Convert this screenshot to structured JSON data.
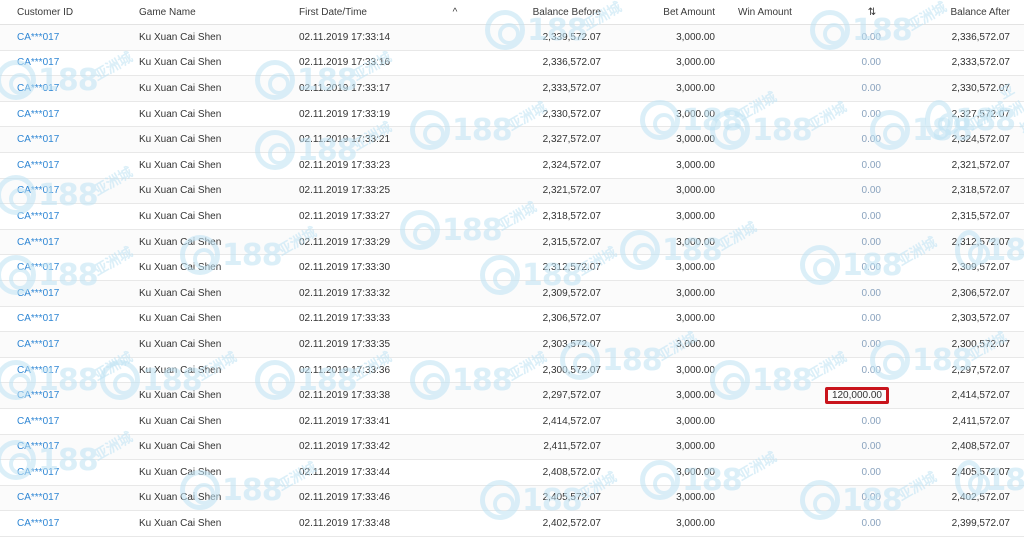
{
  "header": {
    "customer_id": "Customer ID",
    "game_name": "Game Name",
    "first_date": "First Date/Time",
    "sort_up_icon": "^",
    "balance_before": "Balance Before",
    "bet_amount": "Bet Amount",
    "win_amount": "Win Amount",
    "sort_both_icon": "⇅",
    "balance_after": "Balance After"
  },
  "colors": {
    "link": "#2e86d4",
    "win_zero": "#8aa3be",
    "highlight_border": "#c9141c",
    "watermark": "#bfe3f4"
  },
  "watermark": {
    "brand": "188",
    "sub": "亚洲城"
  },
  "rows": [
    {
      "customer": "CA***017",
      "game": "Ku Xuan Cai Shen",
      "date": "02.11.2019 17:33:14",
      "balance_before": "2,339,572.07",
      "bet": "3,000.00",
      "win": "0.00",
      "balance_after": "2,336,572.07"
    },
    {
      "customer": "CA***017",
      "game": "Ku Xuan Cai Shen",
      "date": "02.11.2019 17:33:16",
      "balance_before": "2,336,572.07",
      "bet": "3,000.00",
      "win": "0.00",
      "balance_after": "2,333,572.07"
    },
    {
      "customer": "CA***017",
      "game": "Ku Xuan Cai Shen",
      "date": "02.11.2019 17:33:17",
      "balance_before": "2,333,572.07",
      "bet": "3,000.00",
      "win": "0.00",
      "balance_after": "2,330,572.07"
    },
    {
      "customer": "CA***017",
      "game": "Ku Xuan Cai Shen",
      "date": "02.11.2019 17:33:19",
      "balance_before": "2,330,572.07",
      "bet": "3,000.00",
      "win": "0.00",
      "balance_after": "2,327,572.07"
    },
    {
      "customer": "CA***017",
      "game": "Ku Xuan Cai Shen",
      "date": "02.11.2019 17:33:21",
      "balance_before": "2,327,572.07",
      "bet": "3,000.00",
      "win": "0.00",
      "balance_after": "2,324,572.07"
    },
    {
      "customer": "CA***017",
      "game": "Ku Xuan Cai Shen",
      "date": "02.11.2019 17:33:23",
      "balance_before": "2,324,572.07",
      "bet": "3,000.00",
      "win": "0.00",
      "balance_after": "2,321,572.07"
    },
    {
      "customer": "CA***017",
      "game": "Ku Xuan Cai Shen",
      "date": "02.11.2019 17:33:25",
      "balance_before": "2,321,572.07",
      "bet": "3,000.00",
      "win": "0.00",
      "balance_after": "2,318,572.07"
    },
    {
      "customer": "CA***017",
      "game": "Ku Xuan Cai Shen",
      "date": "02.11.2019 17:33:27",
      "balance_before": "2,318,572.07",
      "bet": "3,000.00",
      "win": "0.00",
      "balance_after": "2,315,572.07"
    },
    {
      "customer": "CA***017",
      "game": "Ku Xuan Cai Shen",
      "date": "02.11.2019 17:33:29",
      "balance_before": "2,315,572.07",
      "bet": "3,000.00",
      "win": "0.00",
      "balance_after": "2,312,572.07"
    },
    {
      "customer": "CA***017",
      "game": "Ku Xuan Cai Shen",
      "date": "02.11.2019 17:33:30",
      "balance_before": "2,312,572.07",
      "bet": "3,000.00",
      "win": "0.00",
      "balance_after": "2,309,572.07"
    },
    {
      "customer": "CA***017",
      "game": "Ku Xuan Cai Shen",
      "date": "02.11.2019 17:33:32",
      "balance_before": "2,309,572.07",
      "bet": "3,000.00",
      "win": "0.00",
      "balance_after": "2,306,572.07"
    },
    {
      "customer": "CA***017",
      "game": "Ku Xuan Cai Shen",
      "date": "02.11.2019 17:33:33",
      "balance_before": "2,306,572.07",
      "bet": "3,000.00",
      "win": "0.00",
      "balance_after": "2,303,572.07"
    },
    {
      "customer": "CA***017",
      "game": "Ku Xuan Cai Shen",
      "date": "02.11.2019 17:33:35",
      "balance_before": "2,303,572.07",
      "bet": "3,000.00",
      "win": "0.00",
      "balance_after": "2,300,572.07"
    },
    {
      "customer": "CA***017",
      "game": "Ku Xuan Cai Shen",
      "date": "02.11.2019 17:33:36",
      "balance_before": "2,300,572.07",
      "bet": "3,000.00",
      "win": "0.00",
      "balance_after": "2,297,572.07"
    },
    {
      "customer": "CA***017",
      "game": "Ku Xuan Cai Shen",
      "date": "02.11.2019 17:33:38",
      "balance_before": "2,297,572.07",
      "bet": "3,000.00",
      "win": "120,000.00",
      "balance_after": "2,414,572.07",
      "highlight": true
    },
    {
      "customer": "CA***017",
      "game": "Ku Xuan Cai Shen",
      "date": "02.11.2019 17:33:41",
      "balance_before": "2,414,572.07",
      "bet": "3,000.00",
      "win": "0.00",
      "balance_after": "2,411,572.07"
    },
    {
      "customer": "CA***017",
      "game": "Ku Xuan Cai Shen",
      "date": "02.11.2019 17:33:42",
      "balance_before": "2,411,572.07",
      "bet": "3,000.00",
      "win": "0.00",
      "balance_after": "2,408,572.07"
    },
    {
      "customer": "CA***017",
      "game": "Ku Xuan Cai Shen",
      "date": "02.11.2019 17:33:44",
      "balance_before": "2,408,572.07",
      "bet": "3,000.00",
      "win": "0.00",
      "balance_after": "2,405,572.07"
    },
    {
      "customer": "CA***017",
      "game": "Ku Xuan Cai Shen",
      "date": "02.11.2019 17:33:46",
      "balance_before": "2,405,572.07",
      "bet": "3,000.00",
      "win": "0.00",
      "balance_after": "2,402,572.07"
    },
    {
      "customer": "CA***017",
      "game": "Ku Xuan Cai Shen",
      "date": "02.11.2019 17:33:48",
      "balance_before": "2,402,572.07",
      "bet": "3,000.00",
      "win": "0.00",
      "balance_after": "2,399,572.07"
    }
  ]
}
